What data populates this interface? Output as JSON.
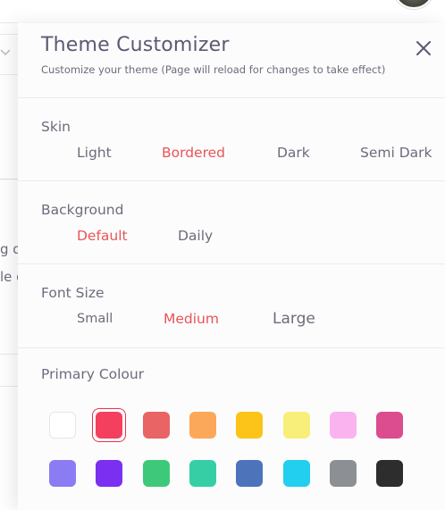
{
  "customizer": {
    "title": "Theme Customizer",
    "subtitle": "Customize your theme (Page will reload for changes to take effect)",
    "close_icon": "close-icon",
    "skin": {
      "label": "Skin",
      "options": [
        "Light",
        "Bordered",
        "Dark",
        "Semi Dark"
      ],
      "selected": "Bordered"
    },
    "background": {
      "label": "Background",
      "options": [
        "Default",
        "Daily"
      ],
      "selected": "Default"
    },
    "font_size": {
      "label": "Font Size",
      "options": [
        "Small",
        "Medium",
        "Large"
      ],
      "selected": "Medium"
    },
    "primary_colour": {
      "label": "Primary Colour",
      "swatches": [
        [
          "#ffffff",
          "#f43f5e",
          "#e96464",
          "#fca85a",
          "#fcc419",
          "#f8ef7a",
          "#fbb3f0",
          "#db4d8f"
        ],
        [
          "#8b7cf4",
          "#7b2ff0",
          "#3ec97a",
          "#36cfa5",
          "#4d73bb",
          "#22cfee",
          "#8c8f94",
          "#2d2d2d"
        ]
      ],
      "selected": "#f43f5e"
    },
    "accent_color": "#ea5455"
  },
  "background_page": {
    "text_fragment_1": "g d",
    "text_fragment_2": "le d"
  }
}
